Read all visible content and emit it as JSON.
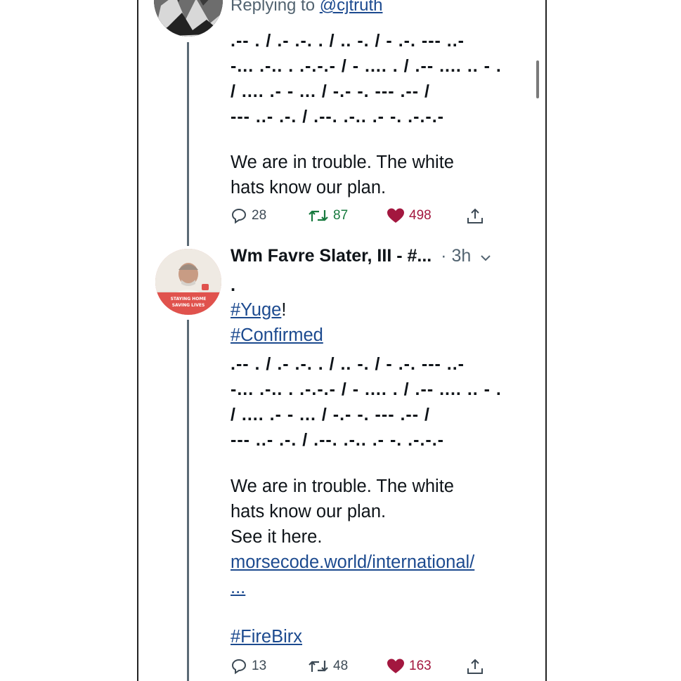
{
  "reply": {
    "label": "Replying to",
    "handle": "@cjtruth"
  },
  "tweet1": {
    "morse": [
      ".-- . / .- .-. . / .. -. / - .-. --- ..-",
      "-... .-.. . .-.-.- / - .... . / .-- .... .. - .",
      "/ .... .- - ... / -.- -. --- .-- /",
      "--- ..- .-. / .--. .-.. .- -. .-.-.-"
    ],
    "text": [
      "We are in trouble. The white",
      "hats know our plan."
    ],
    "replies": "28",
    "retweets": "87",
    "likes": "498"
  },
  "tweet2": {
    "author": "Wm Favre Slater, III - #...",
    "time": "· 3h",
    "dot": ".",
    "hashtag1": "#Yuge",
    "hashtag1_suffix": "!",
    "hashtag2": "#Confirmed",
    "morse": [
      ".-- . / .- .-. . / .. -. / - .-. --- ..-",
      "-... .-.. . .-.-.- / - .... . / .-- .... .. - .",
      "/ .... .- - ... / -.- -. --- .-- /",
      "--- ..- .-. / .--. .-.. .- -. .-.-.-"
    ],
    "text": [
      "We are in trouble. The white",
      "hats know our plan.",
      "See it here."
    ],
    "link": "morsecode.world/international/",
    "link_more": "...",
    "hashtag3": "#FireBirx",
    "replies": "13",
    "retweets": "48",
    "likes": "163",
    "avatar_badge": [
      "STAYING HOME",
      "SAVING LIVES"
    ]
  },
  "colors": {
    "like": "#a3173f",
    "retweet": "#177a3e",
    "link": "#1c4a8f",
    "thread_line": "#5b6a75"
  },
  "icons": [
    "reply-icon",
    "retweet-icon",
    "heart-icon",
    "share-icon",
    "chevron-down-icon"
  ]
}
